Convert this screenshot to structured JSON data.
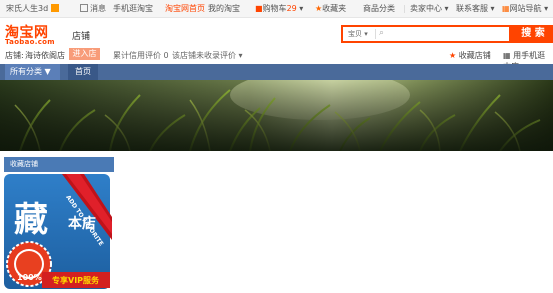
{
  "topbar": {
    "greeting": "宋氏人生3d",
    "messages": "消息",
    "mobile_visit": "手机逛淘宝",
    "homepage": "淘宝网首页",
    "my_taobao": "我的淘宝",
    "cart": "购物车",
    "cart_count": "29",
    "favorites": "收藏夹",
    "categories": "商品分类",
    "seller_center": "卖家中心",
    "support": "联系客服",
    "sitemap": "网站导航"
  },
  "header": {
    "logo_cn": "淘宝网",
    "logo_en": "Taobao.com",
    "store_tag": "店铺",
    "search_scope": "宝贝",
    "search_button": "搜 索"
  },
  "storeline": {
    "label": "店铺:",
    "store_name": "海诗依阁店",
    "enter_button": "进入店铺",
    "rating_label": "累计信用评价",
    "rating_value": "0",
    "complaint_label": "该店铺未收录评价",
    "favorite_store": "收藏店铺",
    "mobile_store": "用手机逛本店"
  },
  "nav": {
    "all_categories": "所有分类",
    "home": "首页"
  },
  "sidebar": {
    "favorite_title": "收藏店铺",
    "badge_main": "藏",
    "badge_store": "本店",
    "badge_ribbon": "ADD TO FAVORITE",
    "badge_percent": "100%",
    "badge_vip": "专享VIP服务"
  },
  "colors": {
    "brand": "#ff4400",
    "nav": "#4a6a9a",
    "module_title": "#4a7ab5"
  }
}
